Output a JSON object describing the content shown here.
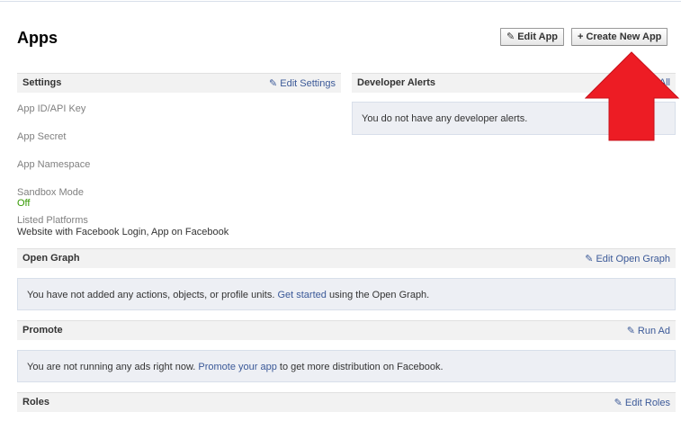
{
  "page": {
    "title": "Apps"
  },
  "toolbar": {
    "edit_app_label": "Edit App",
    "create_app_label": "Create New App",
    "plus": "+"
  },
  "settings": {
    "heading": "Settings",
    "edit_label": "Edit Settings",
    "fields": {
      "app_id_label": "App ID/API Key",
      "app_secret_label": "App Secret",
      "app_namespace_label": "App Namespace",
      "sandbox_label": "Sandbox Mode",
      "sandbox_value": "Off",
      "platforms_label": "Listed Platforms",
      "platforms_value": "Website with Facebook Login, App on Facebook"
    }
  },
  "developer_alerts": {
    "heading": "Developer Alerts",
    "link_fragment": "All",
    "message": "You do not have any developer alerts."
  },
  "open_graph": {
    "heading": "Open Graph",
    "edit_label": "Edit Open Graph",
    "message_before": "You have not added any actions, objects, or profile units.",
    "link": "Get started",
    "message_after": "using the Open Graph."
  },
  "promote": {
    "heading": "Promote",
    "edit_label": "Run Ad",
    "message_before": "You are not running any ads right now.",
    "link": "Promote your app",
    "message_after": "to get more distribution on Facebook."
  },
  "roles": {
    "heading": "Roles",
    "edit_label": "Edit Roles"
  },
  "colors": {
    "link": "#3b5998",
    "bar_bg": "#f2f2f2",
    "panel_bg": "#edeff4",
    "arrow": "#ed1c24",
    "off": "#339900"
  }
}
